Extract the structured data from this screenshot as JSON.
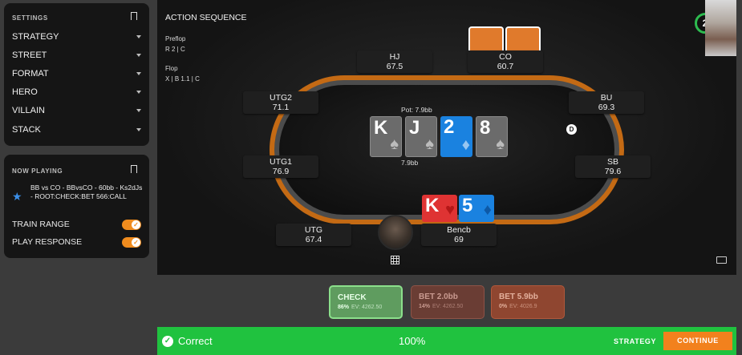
{
  "settings": {
    "header": "SETTINGS",
    "items": [
      {
        "label": "STRATEGY"
      },
      {
        "label": "STREET"
      },
      {
        "label": "FORMAT"
      },
      {
        "label": "HERO"
      },
      {
        "label": "VILLAIN"
      },
      {
        "label": "STACK"
      }
    ]
  },
  "now_playing": {
    "header": "NOW PLAYING",
    "description": "BB vs CO - BBvsCO - 60bb - Ks2dJs - ROOT:CHECK:BET 566:CALL",
    "toggles": [
      {
        "label": "TRAIN RANGE",
        "on": true
      },
      {
        "label": "PLAY RESPONSE",
        "on": true
      }
    ]
  },
  "action_sequence": {
    "title": "ACTION SEQUENCE",
    "preflop_label": "Preflop",
    "preflop_actions": "R 2  |  C",
    "flop_label": "Flop",
    "flop_actions": "X  |  B 1.1  |  C"
  },
  "timer": "2",
  "seats": {
    "hj": {
      "pos": "HJ",
      "stack": "67.5"
    },
    "co": {
      "pos": "CO",
      "stack": "60.7"
    },
    "utg2": {
      "pos": "UTG2",
      "stack": "71.1"
    },
    "bu": {
      "pos": "BU",
      "stack": "69.3"
    },
    "utg1": {
      "pos": "UTG1",
      "stack": "76.9"
    },
    "sb": {
      "pos": "SB",
      "stack": "79.6"
    },
    "utg": {
      "pos": "UTG",
      "stack": "67.4"
    },
    "hero": {
      "pos": "Bencb",
      "stack": "69"
    }
  },
  "pot": {
    "label": "Pot: 7.9bb",
    "amount": "7.9bb"
  },
  "board": [
    {
      "rank": "K",
      "suit": "♠",
      "color": "gray"
    },
    {
      "rank": "J",
      "suit": "♠",
      "color": "gray"
    },
    {
      "rank": "2",
      "suit": "♦",
      "color": "blue"
    },
    {
      "rank": "8",
      "suit": "♠",
      "color": "gray"
    }
  ],
  "hero_cards": [
    {
      "rank": "K",
      "suit": "♥",
      "color": "red"
    },
    {
      "rank": "5",
      "suit": "♦",
      "color": "blue"
    }
  ],
  "dealer_button": "D",
  "actions": [
    {
      "label": "CHECK",
      "freq": "86%",
      "ev": "EV: 4262.50"
    },
    {
      "label": "BET 2.0bb",
      "freq": "14%",
      "ev": "EV: 4262.50"
    },
    {
      "label": "BET 5.9bb",
      "freq": "0%",
      "ev": "EV: 4026.9"
    }
  ],
  "result": {
    "status": "Correct",
    "score": "100%",
    "strategy_link": "STRATEGY",
    "continue_label": "CONTINUE"
  },
  "colors": {
    "accent": "#f2811d",
    "success": "#20c23f",
    "card_blue": "#1a82e0",
    "card_red": "#df3333",
    "card_gray": "#6b6b6b"
  }
}
